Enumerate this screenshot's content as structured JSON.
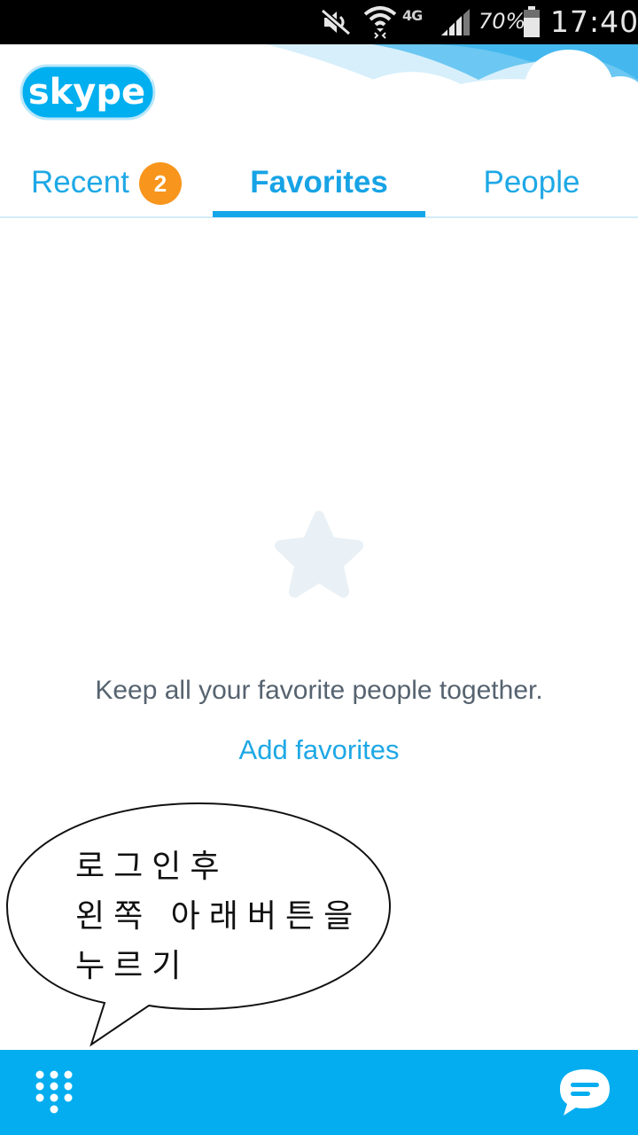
{
  "status_bar": {
    "network": "4G",
    "battery": "70%",
    "time": "17:40",
    "icons": [
      "mute-icon",
      "wifi-icon",
      "network-4g-icon",
      "signal-icon",
      "battery-icon"
    ]
  },
  "header": {
    "logo_text": "skype",
    "colors": {
      "sky": "#44b8ee",
      "sky_light": "#bfe6f8",
      "cloud": "#ffffff"
    }
  },
  "tabs": {
    "recent": {
      "label": "Recent",
      "badge": "2"
    },
    "favorites": {
      "label": "Favorites",
      "active": true
    },
    "people": {
      "label": "People"
    }
  },
  "empty_state": {
    "icon": "star-icon",
    "message": "Keep all your favorite people together.",
    "action": "Add favorites"
  },
  "annotation": {
    "lines": [
      "로그인후",
      "왼쪽 아래버튼을",
      "누르기"
    ]
  },
  "bottom_bar": {
    "left_button_icon": "dialpad-icon",
    "right_button_icon": "chat-icon",
    "color": "#03adef"
  },
  "colors": {
    "accent": "#1ea8e5",
    "badge": "#f8951d",
    "text_muted": "#566370"
  }
}
